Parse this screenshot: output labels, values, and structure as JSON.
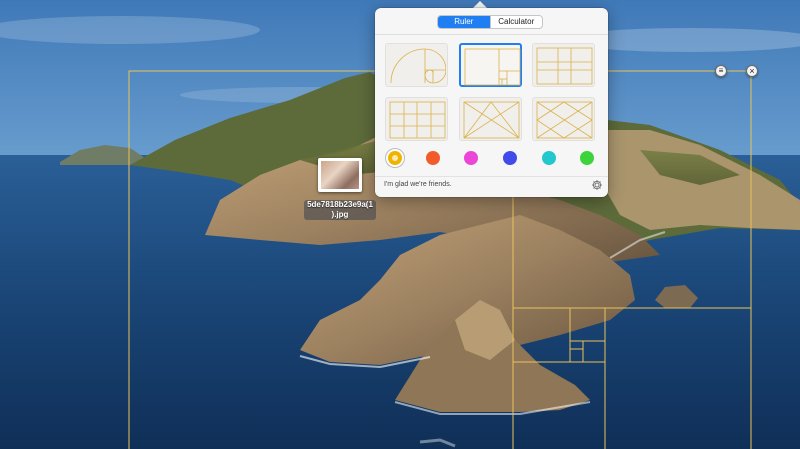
{
  "popover": {
    "tabs": [
      {
        "label": "Ruler",
        "active": true
      },
      {
        "label": "Calculator",
        "active": false
      }
    ],
    "templates": [
      {
        "name": "golden-spiral",
        "selected": false
      },
      {
        "name": "golden-rectangles",
        "selected": true
      },
      {
        "name": "grid-3x3",
        "selected": false
      },
      {
        "name": "grid-4x3",
        "selected": false
      },
      {
        "name": "diagonals",
        "selected": false
      },
      {
        "name": "diagonals-dense",
        "selected": false
      }
    ],
    "colors": [
      "#f0b400",
      "#f25c2a",
      "#ec46d8",
      "#3f4cea",
      "#22c8cd",
      "#3dd43b"
    ],
    "selected_color": "#f0b400",
    "footer_text": "I'm glad we're friends.",
    "settings_icon": "gear-icon"
  },
  "overlay": {
    "line_color": "#e8c35a",
    "menu_icon": "menu-icon",
    "close_icon": "close-icon"
  },
  "desktop": {
    "file_name": "5de7818b23e9a(1).jpg",
    "file_label_line1": "5de7818b23e9a(1",
    "file_label_line2": ").jpg"
  }
}
